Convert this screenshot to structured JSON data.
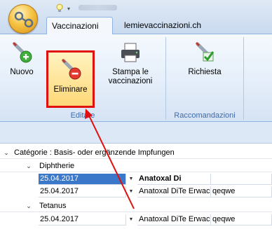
{
  "tabs": {
    "active_label": "Vaccinazioni",
    "other_label": "lemievaccinazioni.ch"
  },
  "ribbon": {
    "buttons": {
      "new_label": "Nuovo",
      "delete_label": "Eliminare",
      "print_line1": "Stampa le",
      "print_line2": "vaccinazioni",
      "request_label": "Richiesta"
    },
    "groups": {
      "edit_label": "Editare",
      "recommend_label": "Raccomandazioni"
    }
  },
  "grid": {
    "category_label": "Catégorie : Basis- oder ergänzende Impfungen",
    "groups": [
      {
        "name": "Diphtherie",
        "rows": [
          {
            "date": "25.04.2017",
            "vaccine": "Anatoxal Di",
            "extra": "",
            "selected": true
          },
          {
            "date": "25.04.2017",
            "vaccine": "Anatoxal DiTe Erwac",
            "extra": "qeqwe",
            "selected": false
          }
        ]
      },
      {
        "name": "Tetanus",
        "rows": [
          {
            "date": "25.04.2017",
            "vaccine": "Anatoxal DiTe Erwac",
            "extra": "qeqwe",
            "selected": false
          }
        ]
      }
    ]
  },
  "colors": {
    "highlight_border": "#e01010",
    "selection": "#3c78c9"
  },
  "icons": {
    "app_orb": "syringe-orb-icon",
    "new": "syringe-plus-icon",
    "delete": "syringe-minus-icon",
    "print": "printer-icon",
    "request": "syringe-check-icon"
  }
}
